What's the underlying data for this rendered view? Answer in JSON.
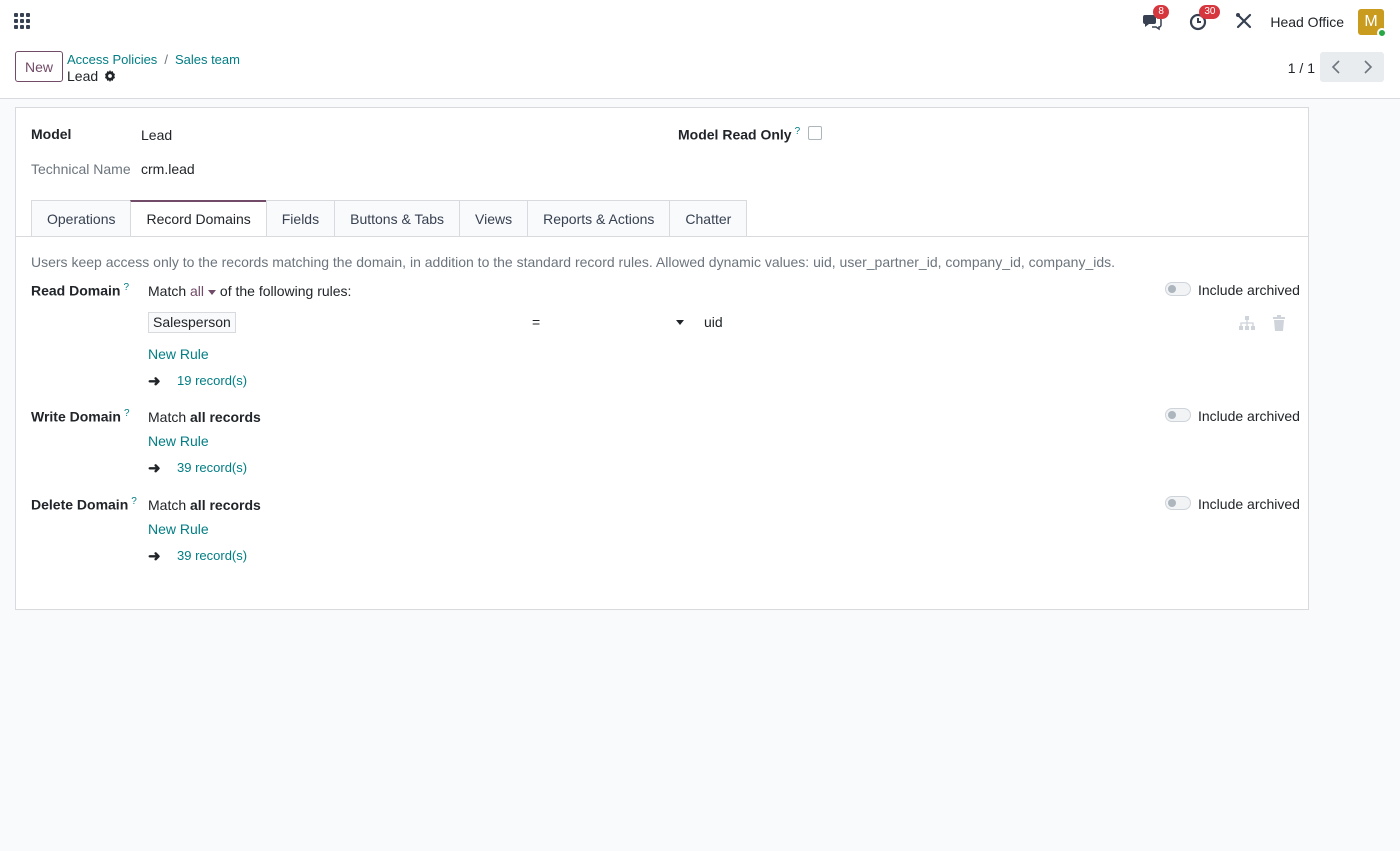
{
  "navbar": {
    "messages_badge": "8",
    "activities_badge": "30",
    "company": "Head Office",
    "avatar_initial": "M"
  },
  "control_panel": {
    "new_label": "New",
    "breadcrumb": [
      "Access Policies",
      "Sales team"
    ],
    "breadcrumb_sep": "/",
    "record_title": "Lead",
    "pager": "1 / 1"
  },
  "form": {
    "model_label": "Model",
    "model_value": "Lead",
    "technical_name_label": "Technical Name",
    "technical_name_value": "crm.lead",
    "model_read_only_label": "Model Read Only",
    "help_mark": "?",
    "tabs": [
      "Operations",
      "Record Domains",
      "Fields",
      "Buttons & Tabs",
      "Views",
      "Reports & Actions",
      "Chatter"
    ],
    "active_tab": "Record Domains",
    "description": "Users keep access only to the records matching the domain, in addition to the standard record rules. Allowed dynamic values: uid, user_partner_id, company_id, company_ids.",
    "include_archived": "Include archived",
    "new_rule": "New Rule",
    "read_domain": {
      "label": "Read Domain",
      "match_prefix": "Match",
      "match_selector": "all",
      "match_suffix": "of the following rules:",
      "rule": {
        "field": "Salesperson",
        "operator": "=",
        "value": "uid"
      },
      "records": "19 record(s)"
    },
    "write_domain": {
      "label": "Write Domain",
      "match_prefix": "Match",
      "match_bold": "all records",
      "records": "39 record(s)"
    },
    "delete_domain": {
      "label": "Delete Domain",
      "match_prefix": "Match",
      "match_bold": "all records",
      "records": "39 record(s)"
    }
  }
}
